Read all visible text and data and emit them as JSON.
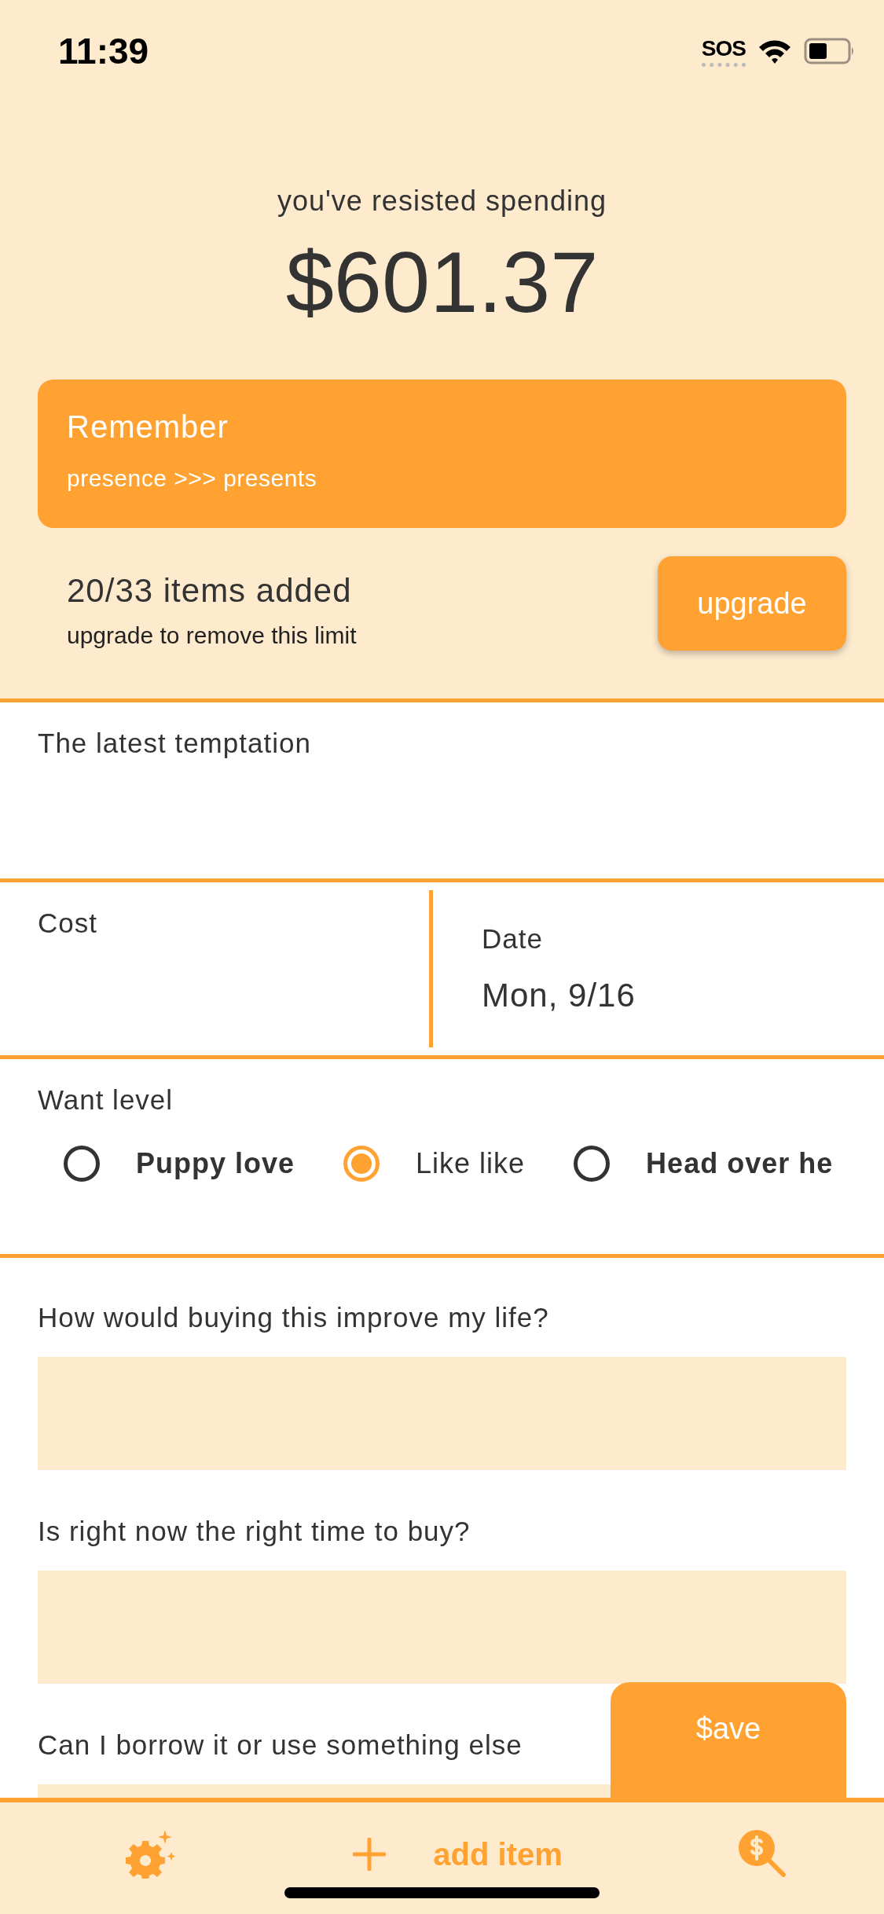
{
  "status_bar": {
    "time": "11:39",
    "sos": "SOS"
  },
  "summary": {
    "caption": "you've resisted spending",
    "amount": "$601.37"
  },
  "reminder": {
    "title": "Remember",
    "text": "presence >>> presents"
  },
  "limit": {
    "count": "20/33 items added",
    "note": "upgrade to remove this limit",
    "button": "upgrade"
  },
  "form": {
    "item": {
      "label": "The latest temptation"
    },
    "cost": {
      "label": "Cost"
    },
    "date": {
      "label": "Date",
      "value": "Mon, 9/16"
    },
    "want_level": {
      "label": "Want level",
      "options": [
        {
          "label": "Puppy love",
          "selected": false
        },
        {
          "label": "Like like",
          "selected": true
        },
        {
          "label": "Head over he",
          "selected": false
        }
      ]
    },
    "questions": [
      {
        "label": "How would buying this improve my life?"
      },
      {
        "label": "Is right now the right time to buy?"
      },
      {
        "label": "Can I borrow it or use something else"
      }
    ],
    "save_button": "$ave"
  },
  "bottom_bar": {
    "add_label": "add item"
  }
}
